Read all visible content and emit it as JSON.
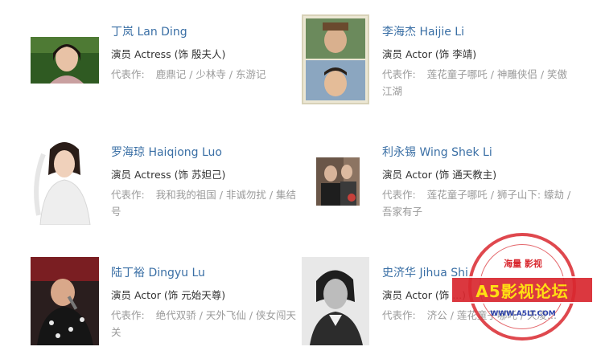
{
  "works_label": "代表作:",
  "cast": [
    {
      "name": "丁岚 Lan Ding",
      "role": "演员 Actress (饰 殷夫人)",
      "works": "鹿鼎记 / 少林寺 / 东游记",
      "photo": "portrait-woman-green-background"
    },
    {
      "name": "李海杰 Haijie Li",
      "role": "演员 Actor (饰 李靖)",
      "works": "莲花童子哪吒 / 神雕侠侣 / 笑傲江湖",
      "photo": "two-costume-stills-collage"
    },
    {
      "name": "罗海琼 Haiqiong Luo",
      "role": "演员 Actress (饰 苏妲己)",
      "works": "我和我的祖国 / 非诚勿扰 / 集结号",
      "photo": "woman-in-white-dress"
    },
    {
      "name": "利永锡 Wing Shek Li",
      "role": "演员 Actor (饰 通天教主)",
      "works": "莲花童子哪吒 / 狮子山下: 蠓劫 / 吾家有子",
      "photo": "two-men-event-photo"
    },
    {
      "name": "陆丁裕 Dingyu Lu",
      "role": "演员 Actor (饰 元始天尊)",
      "works": "绝代双骄 / 天外飞仙 / 侠女闯天关",
      "photo": "man-singing-microphone"
    },
    {
      "name": "史济华 Jihua Shi",
      "role": "演员 Actor (饰 ...)",
      "works": "济公 / 莲花童子哪吒 / 天凌...",
      "photo": "black-white-portrait-woman"
    }
  ],
  "watermark": {
    "top_text": "海量 影视",
    "banner": "A5影视论坛",
    "url": "WWW.A5LT.COM",
    "color": "#d9282f"
  },
  "colors": {
    "name_link": "#3a6fa5",
    "role_text": "#333333",
    "works_text": "#9a9a9a"
  }
}
